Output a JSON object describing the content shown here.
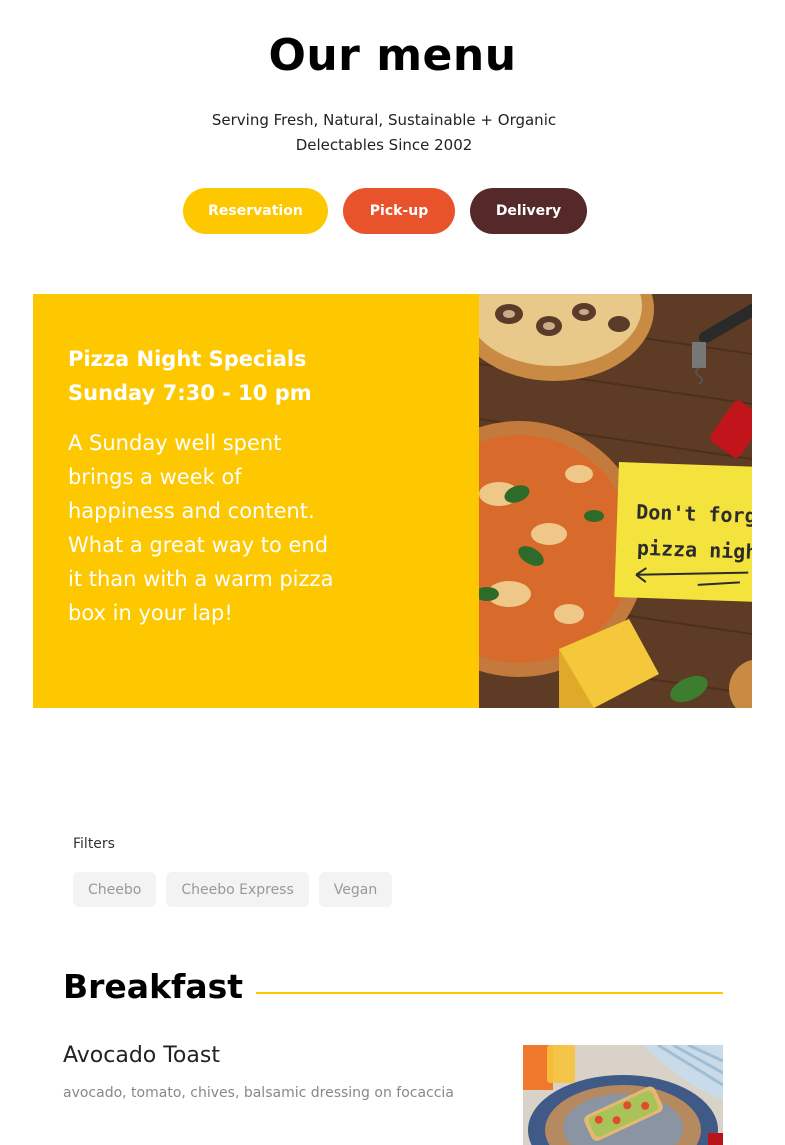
{
  "header": {
    "title": "Our menu",
    "subtitle_line1": "Serving Fresh, Natural, Sustainable + Organic",
    "subtitle_line2": "Delectables Since 2002"
  },
  "actions": {
    "reservation_label": "Reservation",
    "pickup_label": "Pick-up",
    "delivery_label": "Delivery"
  },
  "promo": {
    "heading_line1": "Pizza Night Specials",
    "heading_line2": "Sunday 7:30 - 10 pm",
    "body": "A Sunday well spent brings a week of happiness and content. What a great way to end it than with a warm pizza box in your lap!",
    "note_line1": "Don't forge",
    "note_line2": "pizza night"
  },
  "filters": {
    "label": "Filters",
    "chips": [
      "Cheebo",
      "Cheebo Express",
      "Vegan"
    ]
  },
  "section": {
    "title": "Breakfast",
    "items": [
      {
        "name": "Avocado Toast",
        "description": "avocado, tomato, chives, balsamic dressing on focaccia"
      }
    ]
  },
  "colors": {
    "yellow": "#fdc800",
    "orange": "#e8532b",
    "brown": "#55292a"
  }
}
